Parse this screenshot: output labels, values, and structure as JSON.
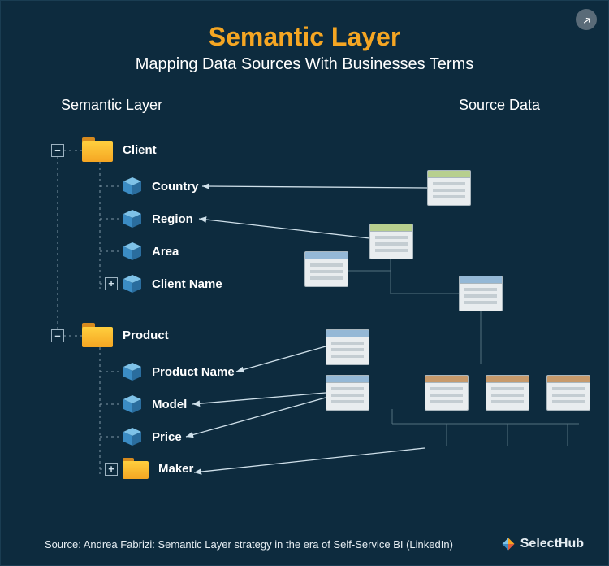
{
  "header": {
    "title": "Semantic Layer",
    "subtitle": "Mapping Data Sources With Businesses Terms"
  },
  "columns": {
    "left_head": "Semantic Layer",
    "right_head": "Source Data"
  },
  "tree": {
    "client": {
      "label": "Client",
      "expander": "–",
      "children": {
        "country": "Country",
        "region": "Region",
        "area": "Area",
        "client_name": "Client Name",
        "client_name_expander": "+"
      }
    },
    "product": {
      "label": "Product",
      "expander": "–",
      "children": {
        "product_name": "Product Name",
        "model": "Model",
        "price": "Price",
        "maker": "Maker",
        "maker_expander": "+"
      }
    }
  },
  "source_windows": [
    {
      "id": "src-a",
      "color": "green"
    },
    {
      "id": "src-b",
      "color": "green"
    },
    {
      "id": "src-c",
      "color": "blue"
    },
    {
      "id": "src-d",
      "color": "blue"
    },
    {
      "id": "src-e",
      "color": "blue"
    },
    {
      "id": "src-f",
      "color": "brown"
    },
    {
      "id": "src-g",
      "color": "brown"
    },
    {
      "id": "src-h",
      "color": "brown"
    }
  ],
  "footer": {
    "source_text": "Source: Andrea Fabrizi: Semantic Layer strategy in the era of Self-Service BI (LinkedIn)",
    "brand": "SelectHub"
  },
  "icons": {
    "share": "share-icon",
    "folder": "folder-icon",
    "cube": "cube-icon",
    "table_window": "table-window-icon"
  }
}
